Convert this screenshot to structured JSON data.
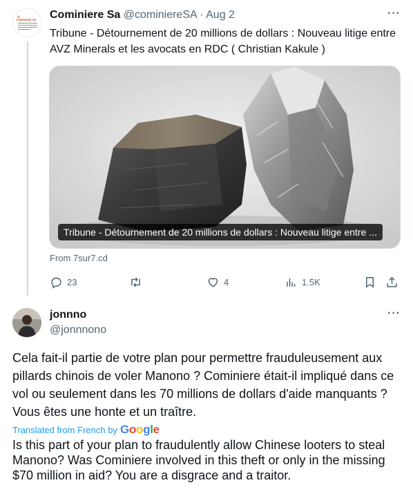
{
  "tweet1": {
    "author_name": "Cominiere Sa",
    "handle_date": "@cominiereSA · Aug 2",
    "more": "···",
    "text": "Tribune - Détournement de 20 millions de dollars : Nouveau litige entre AVZ Minerals et les avocats en RDC ( Christian Kakule )",
    "avatar_logo_text": "COMINIERE SA",
    "media_caption": "Tribune - Détournement de 20 millions de dollars : Nouveau litige entre ...",
    "source": "From 7sur7.cd",
    "actions": {
      "reply_icon": "reply-icon",
      "reply_count": "23",
      "retweet_icon": "retweet-icon",
      "retweet_count": "",
      "like_icon": "heart-icon",
      "like_count": "4",
      "views_icon": "views-icon",
      "views_count": "1.5K",
      "bookmark_icon": "bookmark-icon",
      "share_icon": "share-icon"
    }
  },
  "tweet2": {
    "author_name": "jonnno",
    "handle": "@jonnnono",
    "more": "···",
    "text": "Cela fait-il partie de votre plan pour permettre frauduleusement aux pillards chinois de voler Manono ? Cominiere était-il impliqué dans ce vol ou seulement dans les 70 millions de dollars d'aide manquants ? Vous êtes une honte et un traître.",
    "translated_label": "Translated from French by",
    "google_logo": "Google",
    "translation": "Is this part of your plan to fraudulently allow Chinese looters to steal Manono? Was Cominiere involved in this theft or only in the missing $70 million in aid? You are a disgrace and a traitor."
  },
  "colors": {
    "text": "#0f1419",
    "muted": "#536471",
    "link": "#1d9bf0",
    "border": "#cfd9de"
  }
}
